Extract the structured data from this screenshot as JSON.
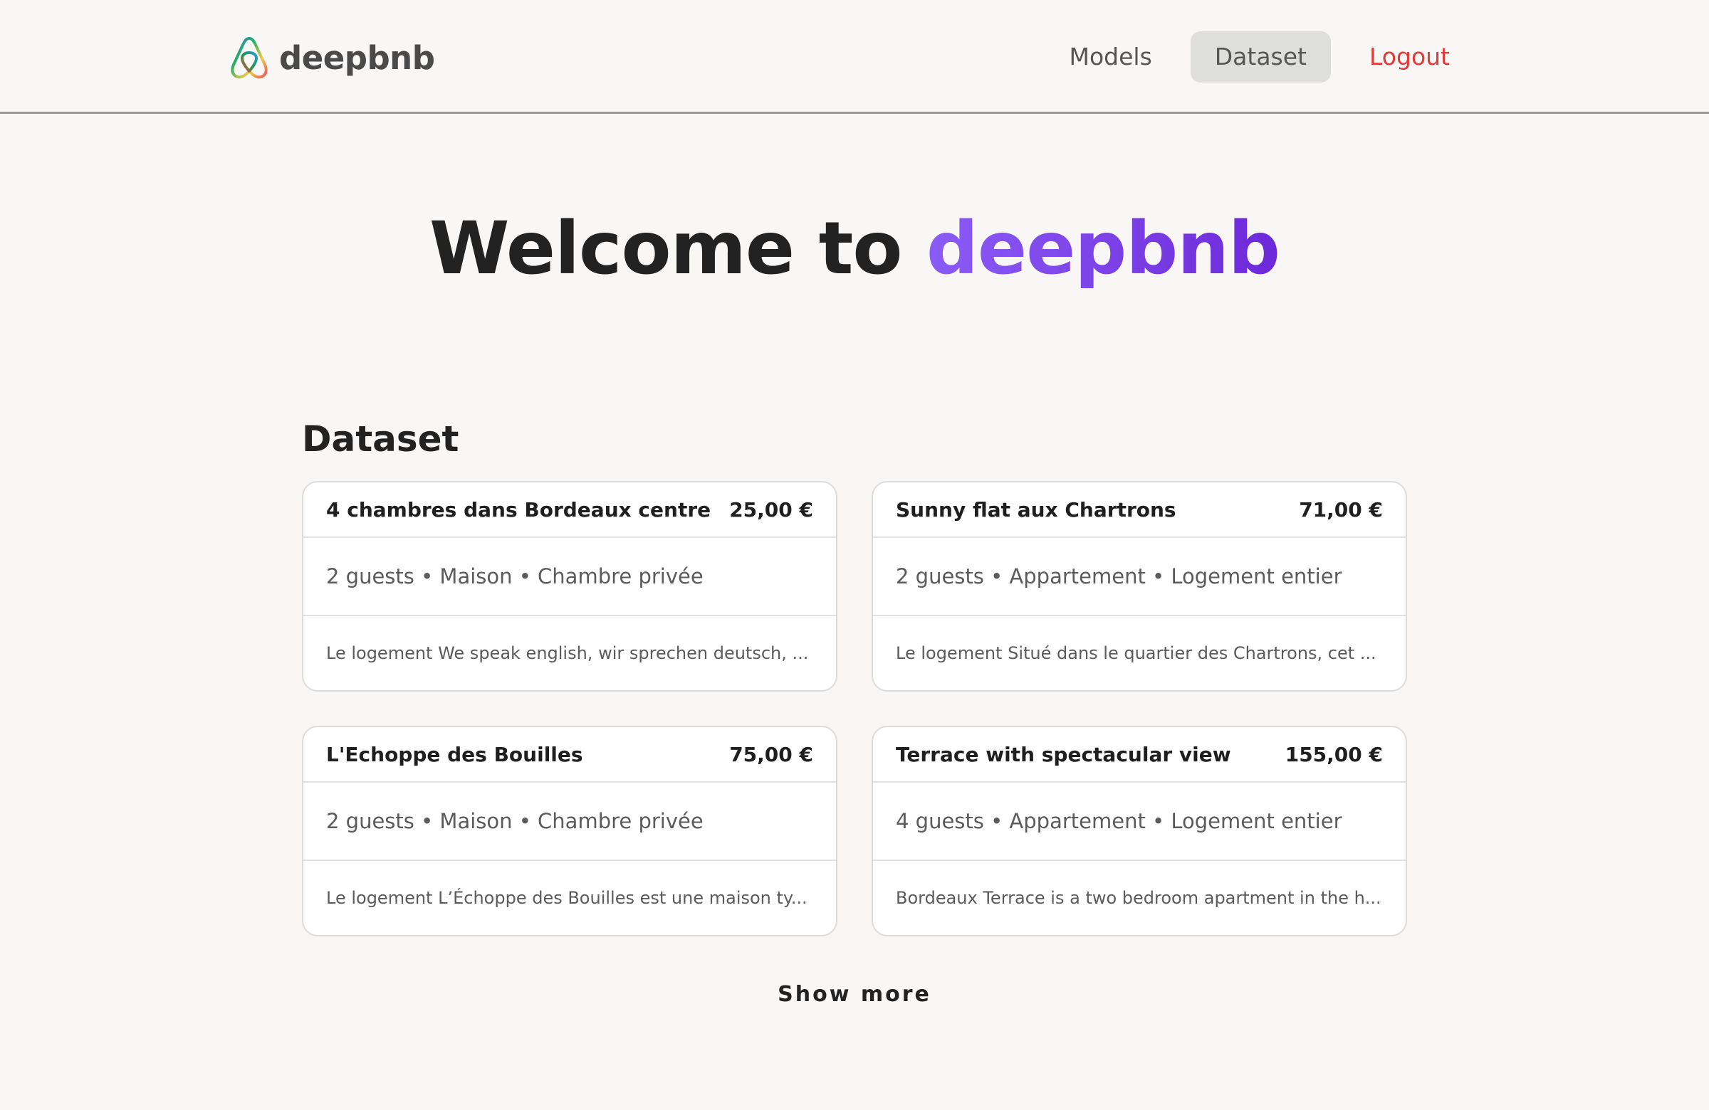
{
  "header": {
    "logo_text": "deepbnb",
    "nav": [
      {
        "label": "Models",
        "active": false
      },
      {
        "label": "Dataset",
        "active": true
      },
      {
        "label": "Logout",
        "active": false
      }
    ]
  },
  "hero": {
    "prefix": "Welcome to ",
    "brand": "deepbnb"
  },
  "dataset": {
    "title": "Dataset",
    "cards": [
      {
        "title": "4 chambres dans Bordeaux centre",
        "price": "25,00 €",
        "meta": "2 guests • Maison • Chambre privée",
        "description": "Le logement We speak english, wir sprechen deutsch, ..."
      },
      {
        "title": "Sunny flat aux Chartrons",
        "price": "71,00 €",
        "meta": "2 guests • Appartement • Logement entier",
        "description": "Le logement Situé dans le quartier des Chartrons, cet ..."
      },
      {
        "title": "L'Echoppe des Bouilles",
        "price": "75,00 €",
        "meta": "2 guests • Maison • Chambre privée",
        "description": "Le logement L’Échoppe des Bouilles est une maison ty..."
      },
      {
        "title": "Terrace with spectacular view",
        "price": "155,00 €",
        "meta": "4 guests • Appartement • Logement entier",
        "description": "Bordeaux Terrace is a two bedroom apartment in the h..."
      }
    ],
    "show_more_label": "Show more"
  },
  "colors": {
    "background": "#f8f7f5",
    "brand_gradient_start": "#8b5cf6",
    "brand_gradient_end": "#6d28d9",
    "logout": "#e53935",
    "nav_active_bg": "#dededc"
  },
  "icons": {
    "logo": "airbnb-belo-icon"
  }
}
